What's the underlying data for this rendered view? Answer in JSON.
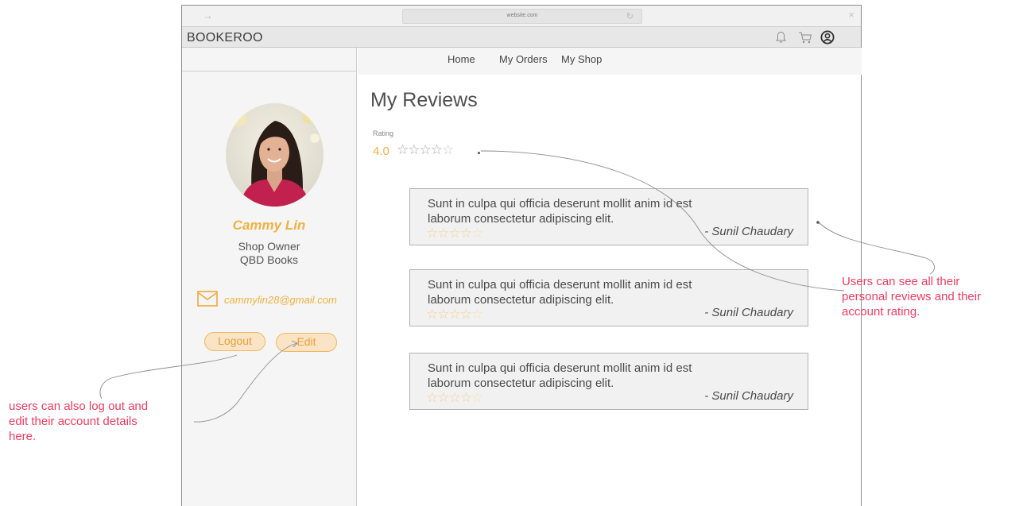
{
  "browser": {
    "url": "website.com"
  },
  "app": {
    "brand": "BOOKEROO"
  },
  "nav": {
    "items": [
      "Home",
      "My Orders",
      "My Shop"
    ]
  },
  "profile": {
    "name": "Cammy Lin",
    "role": "Shop Owner",
    "shop": "QBD Books",
    "email": "cammylin28@gmail.com",
    "logout_label": "Logout",
    "edit_label": "Edit"
  },
  "reviews_page": {
    "title": "My Reviews",
    "rating_label": "Rating",
    "rating_value": "4.0",
    "rating_stars": 4,
    "reviews": [
      {
        "line1": "Sunt in culpa qui officia deserunt mollit anim id est",
        "line2": "laborum consectetur adipiscing elit.",
        "author": "- Sunil Chaudary",
        "stars": 4
      },
      {
        "line1": "Sunt in culpa qui officia deserunt mollit anim id est",
        "line2": "laborum consectetur adipiscing elit.",
        "author": "- Sunil Chaudary",
        "stars": 4
      },
      {
        "line1": "Sunt in culpa qui officia deserunt mollit anim id est",
        "line2": "laborum consectetur adipiscing elit.",
        "author": "- Sunil Chaudary",
        "stars": 4
      }
    ]
  },
  "annotations": {
    "right": [
      "Users can see all their",
      "personal reviews and their",
      "account rating."
    ],
    "left": [
      "users can also log out and",
      "edit their account details",
      "here."
    ]
  },
  "colors": {
    "accent": "#f0b141",
    "annotation": "#ec3c61",
    "star_filled": "#f6cf91"
  }
}
